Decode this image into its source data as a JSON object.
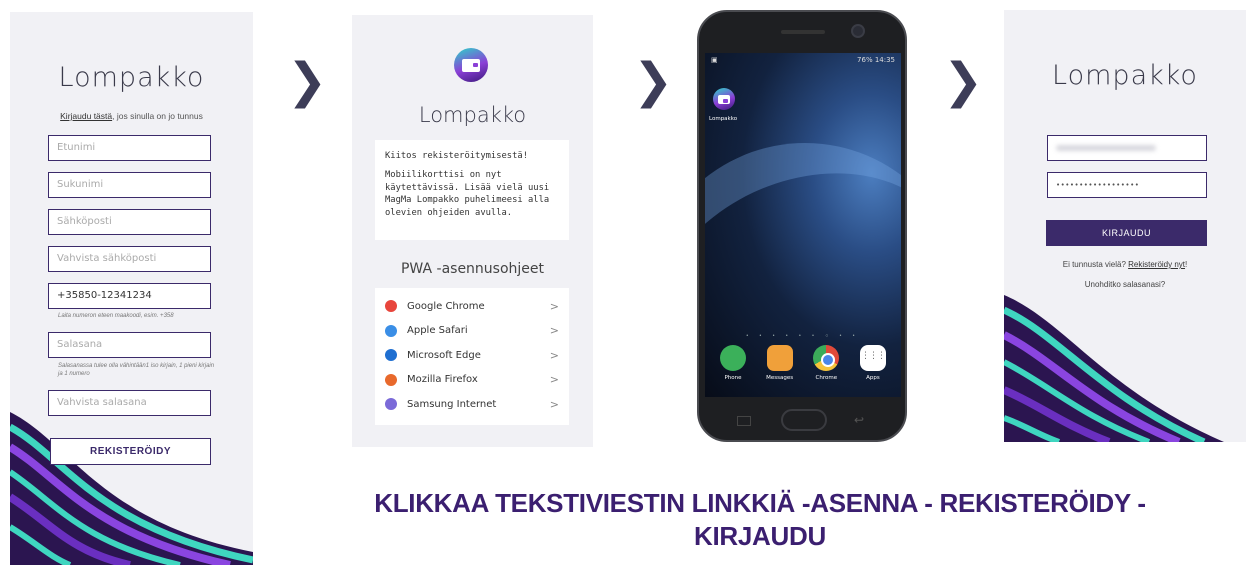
{
  "register": {
    "brand": "Lompakko",
    "login_link": "Kirjaudu tästä",
    "login_hint_rest": ", jos sinulla on jo tunnus",
    "fields": {
      "firstname": "Etunimi",
      "lastname": "Sukunimi",
      "email": "Sähköposti",
      "email_confirm": "Vahvista sähköposti",
      "phone_value": "+35850-12341234",
      "password": "Salasana",
      "password_confirm": "Vahvista salasana"
    },
    "phone_hint": "Laita numeron eteen maakoodi, esim. +358",
    "password_hint": "Salasanassa tulee olla vähintään1 iso kirjain, 1 pieni kirjain ja 1 numero",
    "submit_label": "REKISTERÖIDY"
  },
  "arrows": {
    "glyph": "❯"
  },
  "thanks": {
    "brand": "Lompakko",
    "message_1": "Kiitos rekisteröitymisestä!",
    "message_2": "Mobiilikorttisi on nyt käytettävissä. Lisää vielä uusi MagMa Lompakko puhelimeesi alla olevien ohjeiden avulla.",
    "pwa_title": "PWA -asennusohjeet",
    "browsers": [
      {
        "name": "Google Chrome",
        "color": "#e8453c",
        "icon": "chrome-icon"
      },
      {
        "name": "Apple Safari",
        "color": "#3a8ee6",
        "icon": "safari-icon"
      },
      {
        "name": "Microsoft Edge",
        "color": "#1f6fd1",
        "icon": "edge-icon"
      },
      {
        "name": "Mozilla Firefox",
        "color": "#e8692c",
        "icon": "firefox-icon"
      },
      {
        "name": "Samsung Internet",
        "color": "#7b6ad8",
        "icon": "samsung-internet-icon"
      }
    ],
    "chevron": ">"
  },
  "phone": {
    "status": "76% 14:35",
    "app_label": "Lompakko",
    "dock": [
      "Phone",
      "Messages",
      "Chrome",
      "Apps"
    ]
  },
  "login": {
    "brand": "Lompakko",
    "password_mask": "••••••••••••••••••",
    "submit_label": "KIRJAUDU",
    "register_hint_prefix": "Ei tunnusta vielä? ",
    "register_link": "Rekisteröidy nyt",
    "register_hint_suffix": "!",
    "forgot_label": "Unohditko salasanasi?"
  },
  "caption": {
    "line1": "KLIKKAA TEKSTIVIESTIN LINKKIÄ -ASENNA - REKISTERÖIDY -",
    "line2": "KIRJAUDU"
  },
  "colors": {
    "brand_purple": "#3b2a6a",
    "caption": "#3b1f70"
  }
}
